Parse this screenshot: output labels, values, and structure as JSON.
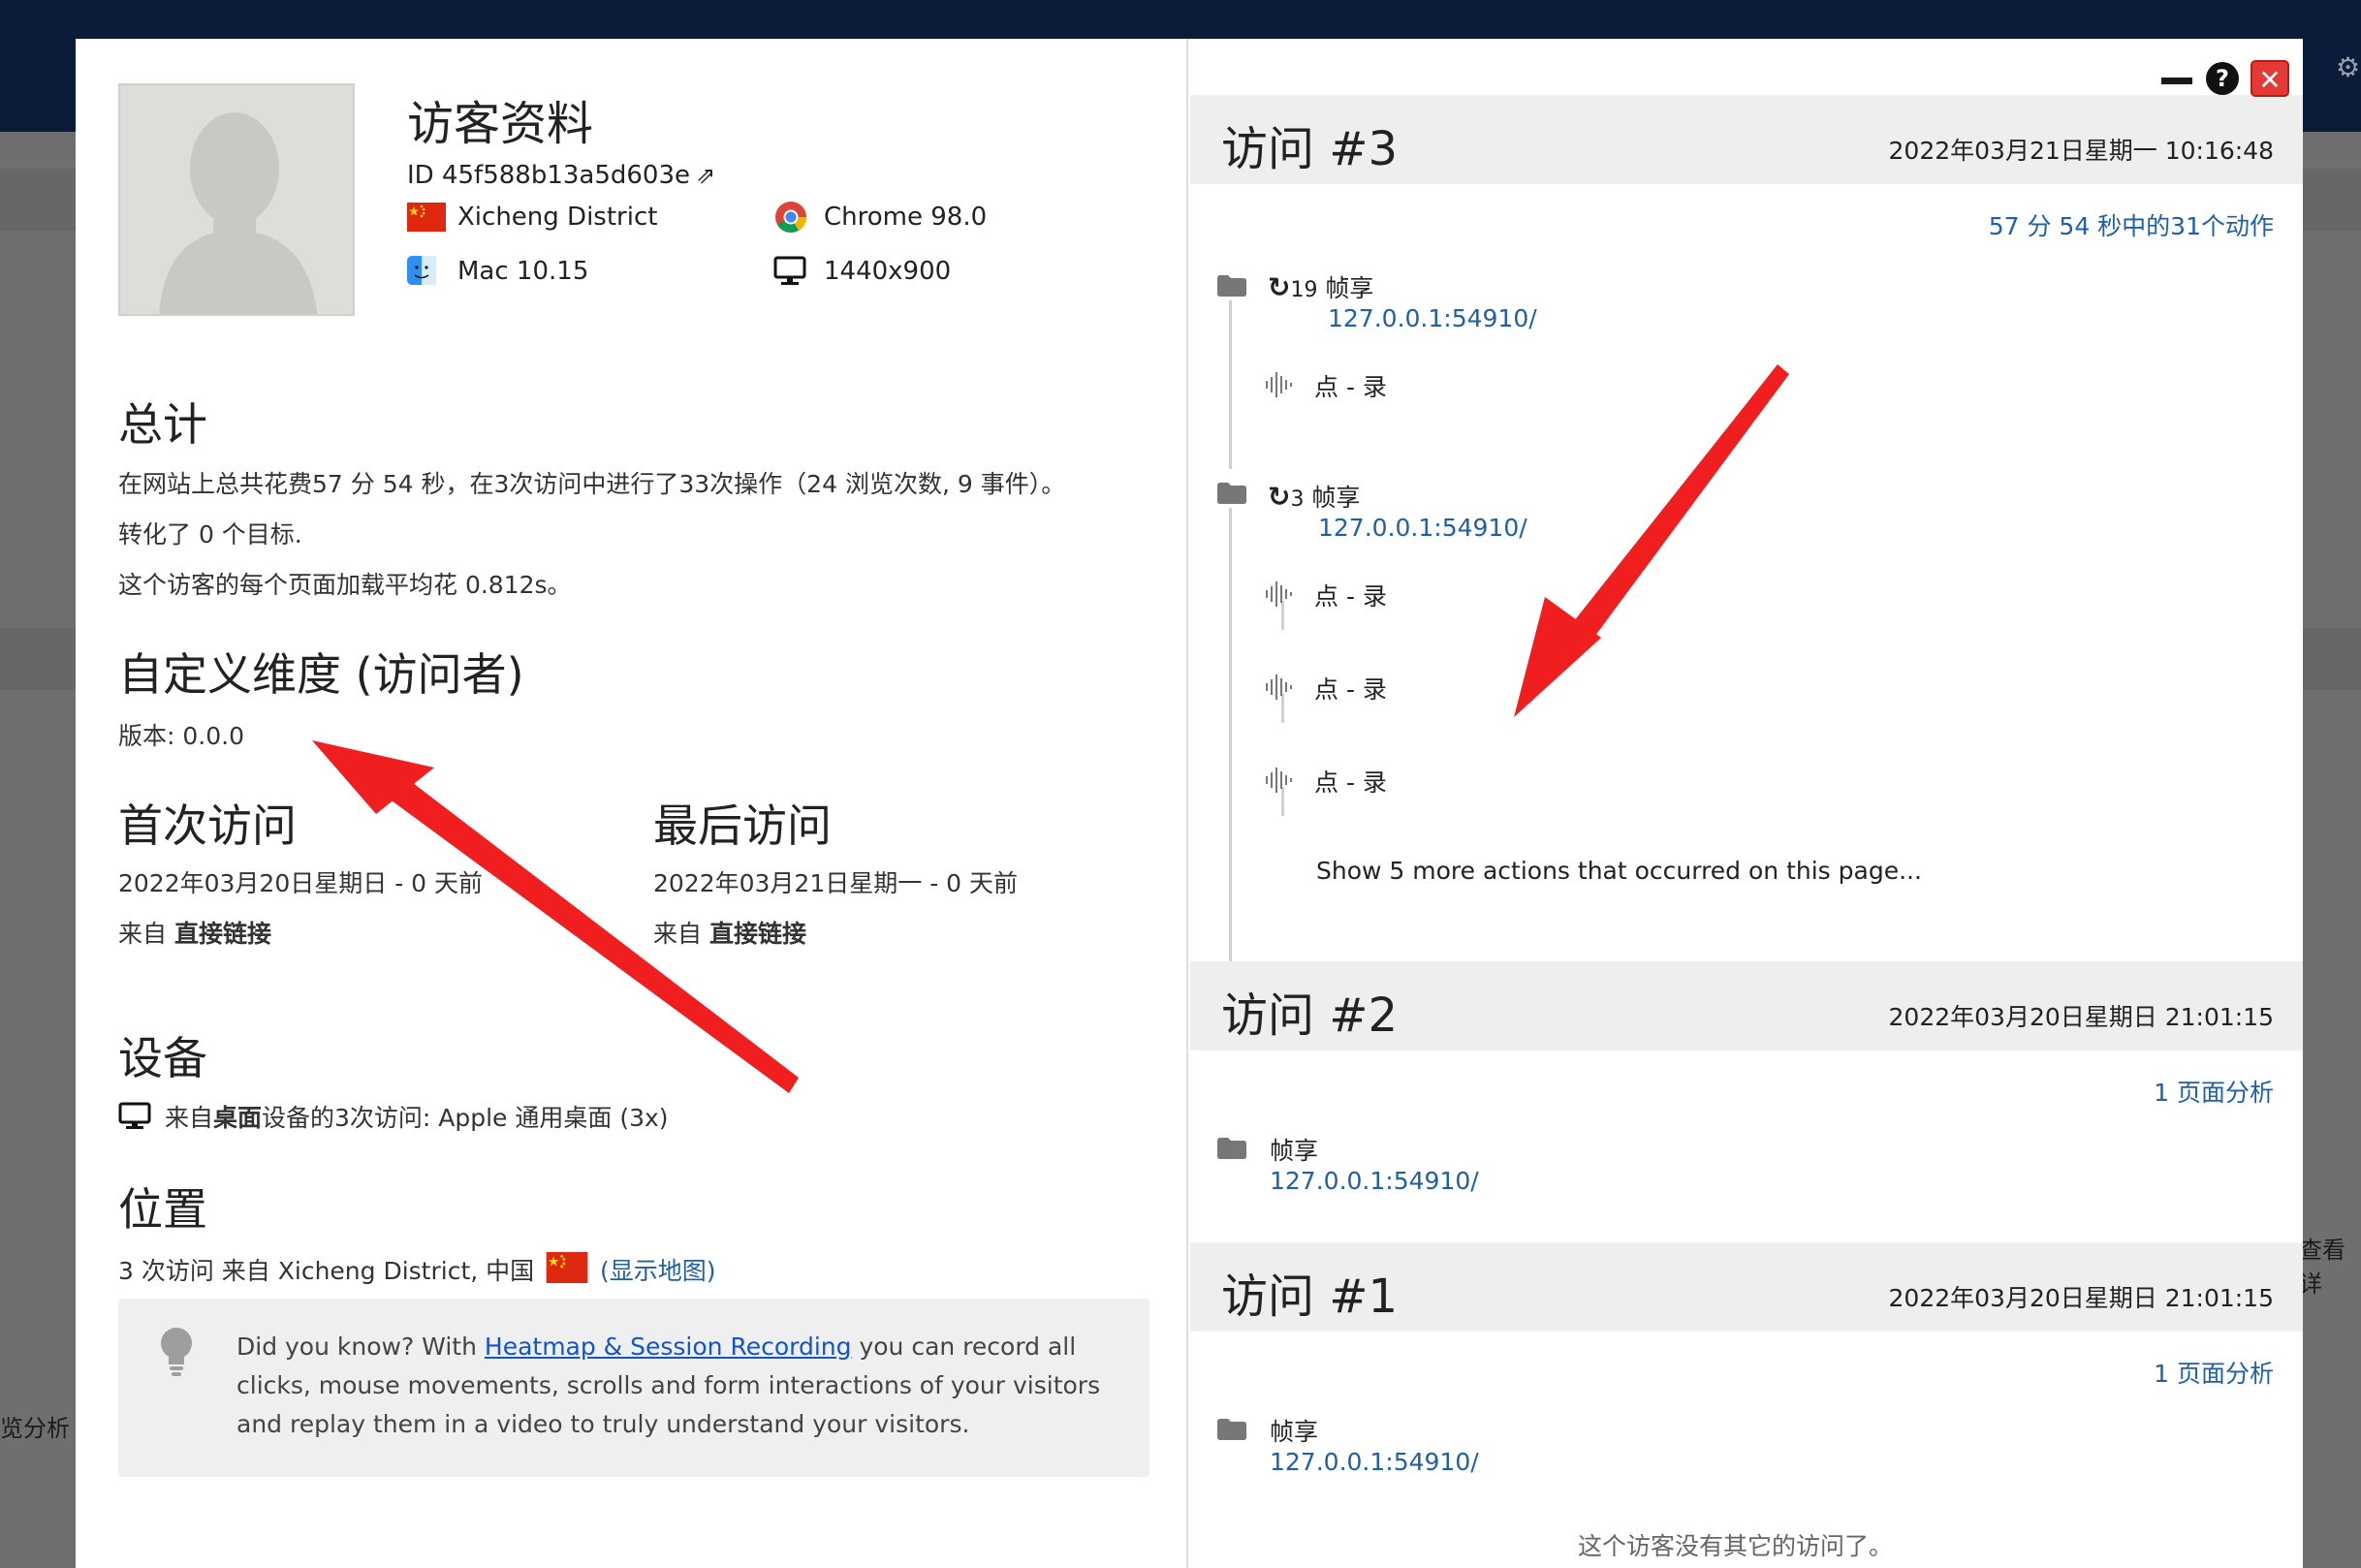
{
  "background": {
    "left_text": "览分析",
    "right_text": "查看详"
  },
  "window_controls": {
    "minimize_label": "—",
    "help_label": "?",
    "close_label": "✕"
  },
  "profile": {
    "title": "访客资料",
    "visitor_id": "ID 45f588b13a5d603e",
    "location": "Xicheng District",
    "browser": "Chrome 98.0",
    "os": "Mac 10.15",
    "resolution": "1440x900"
  },
  "summary": {
    "heading": "总计",
    "line1": "在网站上总共花费57 分 54 秒，在3次访问中进行了33次操作（24 浏览次数, 9 事件）。",
    "line2": "转化了 0 个目标.",
    "line3": "这个访客的每个页面加载平均花 0.812s。"
  },
  "custom_dimensions": {
    "heading": "自定义维度 (访问者)",
    "version_label": "版本:",
    "version_value": "0.0.0"
  },
  "first_visit": {
    "heading": "首次访问",
    "date": "2022年03月20日星期日 - 0 天前",
    "from_label": "来自",
    "from_value": "直接链接"
  },
  "last_visit": {
    "heading": "最后访问",
    "date": "2022年03月21日星期一 - 0 天前",
    "from_label": "来自",
    "from_value": "直接链接"
  },
  "devices": {
    "heading": "设备",
    "text_prefix": "来自",
    "device_type": "桌面",
    "text_suffix": "设备的3次访问: Apple 通用桌面 (3x)"
  },
  "location_section": {
    "heading": "位置",
    "text": "3 次访问 来自 Xicheng District, 中国",
    "map_link": "(显示地图)"
  },
  "tip": {
    "before": "Did you know? With ",
    "link": "Heatmap & Session Recording",
    "after": " you can record all clicks, mouse movements, scrolls and form interactions of your visitors and replay them in a video to truly understand your visitors."
  },
  "visits": [
    {
      "title": "访问 #3",
      "date": "2022年03月21日星期一 10:16:48",
      "summary": "57 分 54 秒中的31个动作",
      "pages": [
        {
          "repeat": "19",
          "label": "帧享",
          "url": "127.0.0.1:54910/",
          "actions": [
            "点 - 录"
          ]
        },
        {
          "repeat": "3",
          "label": "帧享",
          "url": "127.0.0.1:54910/",
          "actions": [
            "点 - 录",
            "点 - 录",
            "点 - 录"
          ],
          "show_more": "Show 5 more actions that occurred on this page..."
        }
      ]
    },
    {
      "title": "访问 #2",
      "date": "2022年03月20日星期日 21:01:15",
      "summary": "1 页面分析",
      "pages": [
        {
          "label": "帧享",
          "url": "127.0.0.1:54910/"
        }
      ]
    },
    {
      "title": "访问 #1",
      "date": "2022年03月20日星期日 21:01:15",
      "summary": "1 页面分析",
      "pages": [
        {
          "label": "帧享",
          "url": "127.0.0.1:54910/"
        }
      ]
    }
  ],
  "no_more_visits": "这个访客没有其它的访问了。",
  "colors": {
    "link": "#1e5fa8",
    "arrow": "#f01e1e",
    "close_button": "#e53935",
    "header_bar": "#0b1b3a"
  }
}
